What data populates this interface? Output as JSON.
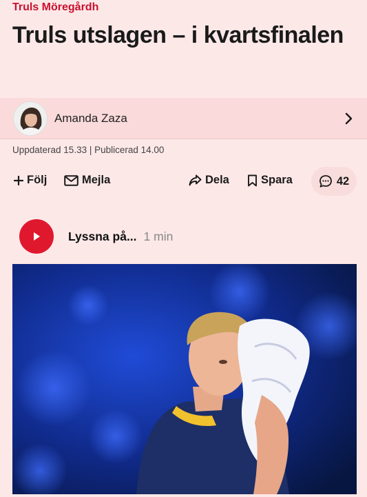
{
  "article": {
    "kicker": "Truls Möregårdh",
    "headline": "Truls utslagen – i kvartsfinalen"
  },
  "byline": {
    "author": "Amanda Zaza",
    "avatar_icon": "author-avatar",
    "chevron_icon": "chevron-right-icon"
  },
  "meta": {
    "timestamps": "Uppdaterad 15.33 | Publicerad 14.00"
  },
  "actions": {
    "follow_label": "Följ",
    "email_label": "Mejla",
    "share_label": "Dela",
    "save_label": "Spara",
    "comments_count": "42"
  },
  "audio": {
    "listen_label": "Lyssna på...",
    "duration": "1 min"
  },
  "colors": {
    "background": "#fde8e8",
    "brand_red": "#c8102e",
    "play_red": "#e0182e"
  }
}
